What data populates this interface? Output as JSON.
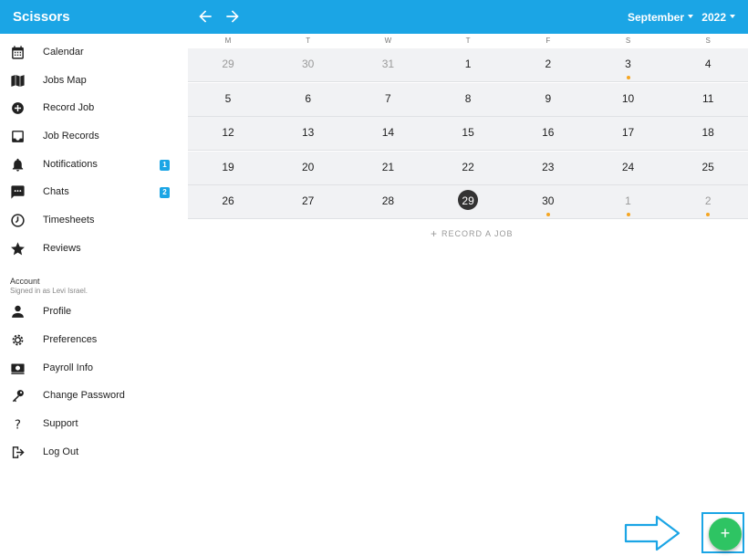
{
  "header": {
    "title": "Scissors",
    "month": "September",
    "year": "2022"
  },
  "sidebar": {
    "items": [
      {
        "label": "Calendar",
        "icon": "calendar-icon"
      },
      {
        "label": "Jobs Map",
        "icon": "map-icon"
      },
      {
        "label": "Record Job",
        "icon": "add-circle-icon"
      },
      {
        "label": "Job Records",
        "icon": "inbox-icon"
      },
      {
        "label": "Notifications",
        "icon": "bell-icon",
        "badge": "1"
      },
      {
        "label": "Chats",
        "icon": "chat-icon",
        "badge": "2"
      },
      {
        "label": "Timesheets",
        "icon": "timer-icon"
      },
      {
        "label": "Reviews",
        "icon": "star-icon"
      }
    ],
    "account_heading": "Account",
    "account_sub": "Signed in as Levi Israel.",
    "account_items": [
      {
        "label": "Profile",
        "icon": "person-icon"
      },
      {
        "label": "Preferences",
        "icon": "gear-icon"
      },
      {
        "label": "Payroll Info",
        "icon": "cash-icon"
      },
      {
        "label": "Change Password",
        "icon": "key-icon"
      },
      {
        "label": "Support",
        "icon": "question-icon"
      },
      {
        "label": "Log Out",
        "icon": "logout-icon"
      }
    ]
  },
  "calendar": {
    "weekdays": [
      "M",
      "T",
      "W",
      "T",
      "F",
      "S",
      "S"
    ],
    "weeks": [
      [
        {
          "d": "29",
          "muted": true
        },
        {
          "d": "30",
          "muted": true
        },
        {
          "d": "31",
          "muted": true
        },
        {
          "d": "1"
        },
        {
          "d": "2"
        },
        {
          "d": "3",
          "dot": true
        },
        {
          "d": "4"
        }
      ],
      [
        {
          "d": "5"
        },
        {
          "d": "6"
        },
        {
          "d": "7"
        },
        {
          "d": "8"
        },
        {
          "d": "9"
        },
        {
          "d": "10"
        },
        {
          "d": "11"
        }
      ],
      [
        {
          "d": "12"
        },
        {
          "d": "13"
        },
        {
          "d": "14"
        },
        {
          "d": "15"
        },
        {
          "d": "16"
        },
        {
          "d": "17"
        },
        {
          "d": "18"
        }
      ],
      [
        {
          "d": "19"
        },
        {
          "d": "20"
        },
        {
          "d": "21"
        },
        {
          "d": "22"
        },
        {
          "d": "23"
        },
        {
          "d": "24"
        },
        {
          "d": "25"
        }
      ],
      [
        {
          "d": "26"
        },
        {
          "d": "27"
        },
        {
          "d": "28"
        },
        {
          "d": "29",
          "today": true
        },
        {
          "d": "30",
          "dot": true
        },
        {
          "d": "1",
          "muted": true,
          "dot": true
        },
        {
          "d": "2",
          "muted": true,
          "dot": true
        }
      ]
    ],
    "record_label": "RECORD A JOB"
  },
  "fab": {
    "label": "+"
  },
  "colors": {
    "primary": "#1ba5e5",
    "fab": "#2ec463",
    "event_dot": "#f5a623",
    "today": "#333333"
  }
}
